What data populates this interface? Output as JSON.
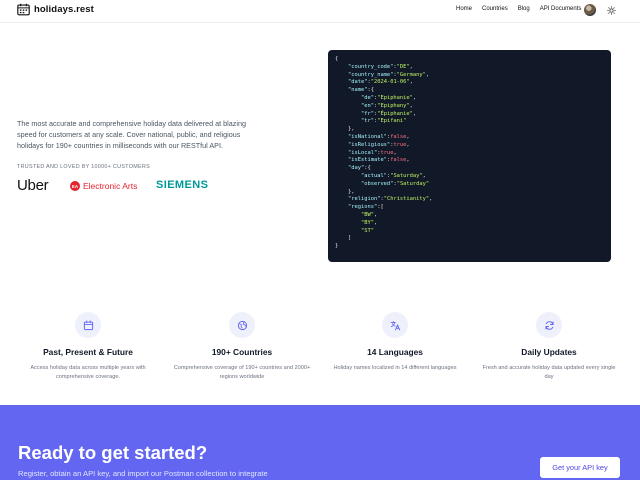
{
  "brand": {
    "name": "holidays.rest"
  },
  "nav": {
    "items": [
      "Home",
      "Countries",
      "Blog",
      "API Documents"
    ]
  },
  "hero": {
    "description": "The most accurate and comprehensive holiday data delivered at blazing speed for customers at any scale. Cover national, public, and religious holidays for 190+ countries in milliseconds with our RESTful API.",
    "trusted_label": "TRUSTED AND LOVED BY 10000+ CUSTOMERS",
    "brands": {
      "uber": "Uber",
      "ea_badge": "EA",
      "ea": "Electronic Arts",
      "siemens": "SIEMENS"
    }
  },
  "code_sample": {
    "country_code": "DE",
    "country_name": "Germany",
    "date": "2024-01-06",
    "name": {
      "de": "Epiphanie",
      "en": "Epiphany",
      "fr": "Épiphanie",
      "tr": "Epifani"
    },
    "isNational": "false",
    "isReligious": "true",
    "isLocal": "true",
    "isEstimate": "false",
    "day": {
      "actual": "Saturday",
      "observed": "Saturday"
    },
    "religion": "Christianity",
    "regions": [
      "BW",
      "BY",
      "ST"
    ]
  },
  "features": [
    {
      "icon": "calendar-icon",
      "title": "Past, Present & Future",
      "desc": "Access holiday data across multiple years with comprehensive coverage."
    },
    {
      "icon": "globe-icon",
      "title": "190+ Countries",
      "desc": "Comprehensive coverage of 190+ countries and 2000+ regions worldwide"
    },
    {
      "icon": "translate-icon",
      "title": "14 Languages",
      "desc": "Holiday names localized in 14 different languages"
    },
    {
      "icon": "refresh-icon",
      "title": "Daily Updates",
      "desc": "Fresh and accurate holiday data updated every single day"
    }
  ],
  "cta": {
    "title": "Ready to get started?",
    "desc": "Register, obtain an API key, and import our Postman collection to integrate",
    "button": "Get your API key"
  },
  "colors": {
    "accent": "#6366f1",
    "code_bg": "#111827",
    "key": "#a5f3fc",
    "string": "#bef264",
    "boolean": "#fb7185"
  }
}
